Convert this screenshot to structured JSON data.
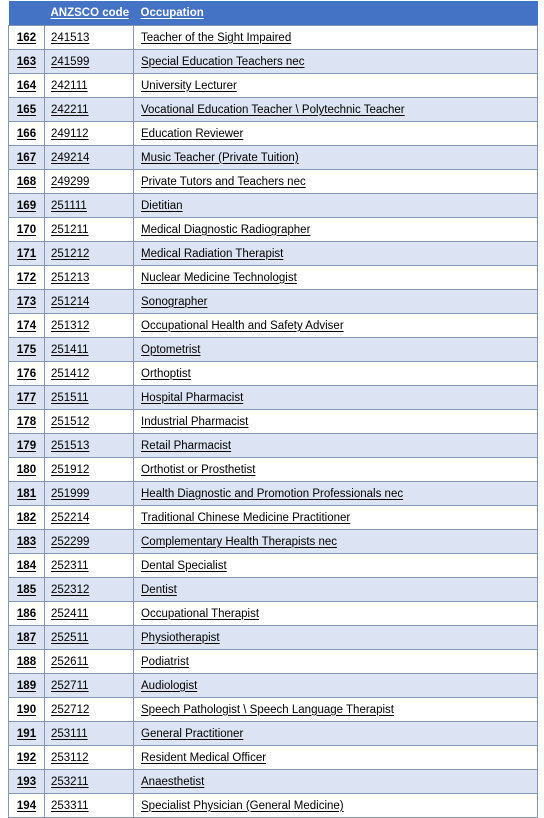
{
  "table": {
    "columns": [
      "",
      "ANZSCO code",
      "Occupation"
    ],
    "header": {
      "index_label": "",
      "code_label": "ANZSCO code",
      "occupation_label": "Occupation"
    },
    "rows": [
      {
        "index": "162",
        "code": "241513",
        "occupation": "Teacher of the Sight Impaired"
      },
      {
        "index": "163",
        "code": "241599",
        "occupation": "Special Education Teachers nec"
      },
      {
        "index": "164",
        "code": "242111",
        "occupation": "University Lecturer"
      },
      {
        "index": "165",
        "code": "242211",
        "occupation": "Vocational Education Teacher \\ Polytechnic Teacher"
      },
      {
        "index": "166",
        "code": "249112",
        "occupation": "Education Reviewer"
      },
      {
        "index": "167",
        "code": "249214",
        "occupation": "Music Teacher (Private Tuition)"
      },
      {
        "index": "168",
        "code": "249299",
        "occupation": "Private Tutors and Teachers nec"
      },
      {
        "index": "169",
        "code": "251111",
        "occupation": "Dietitian"
      },
      {
        "index": "170",
        "code": "251211",
        "occupation": "Medical Diagnostic Radiographer"
      },
      {
        "index": "171",
        "code": "251212",
        "occupation": "Medical Radiation Therapist"
      },
      {
        "index": "172",
        "code": "251213",
        "occupation": "Nuclear Medicine Technologist"
      },
      {
        "index": "173",
        "code": "251214",
        "occupation": "Sonographer"
      },
      {
        "index": "174",
        "code": "251312",
        "occupation": "Occupational Health and Safety Adviser"
      },
      {
        "index": "175",
        "code": "251411",
        "occupation": "Optometrist"
      },
      {
        "index": "176",
        "code": "251412",
        "occupation": "Orthoptist"
      },
      {
        "index": "177",
        "code": "251511",
        "occupation": "Hospital Pharmacist"
      },
      {
        "index": "178",
        "code": "251512",
        "occupation": "Industrial Pharmacist"
      },
      {
        "index": "179",
        "code": "251513",
        "occupation": "Retail Pharmacist"
      },
      {
        "index": "180",
        "code": "251912",
        "occupation": "Orthotist or Prosthetist"
      },
      {
        "index": "181",
        "code": "251999",
        "occupation": "Health Diagnostic and Promotion Professionals nec"
      },
      {
        "index": "182",
        "code": "252214",
        "occupation": "Traditional Chinese Medicine Practitioner"
      },
      {
        "index": "183",
        "code": "252299",
        "occupation": "Complementary Health Therapists nec"
      },
      {
        "index": "184",
        "code": "252311",
        "occupation": "Dental Specialist"
      },
      {
        "index": "185",
        "code": "252312",
        "occupation": "Dentist"
      },
      {
        "index": "186",
        "code": "252411",
        "occupation": "Occupational Therapist"
      },
      {
        "index": "187",
        "code": "252511",
        "occupation": "Physiotherapist"
      },
      {
        "index": "188",
        "code": "252611",
        "occupation": "Podiatrist"
      },
      {
        "index": "189",
        "code": "252711",
        "occupation": "Audiologist"
      },
      {
        "index": "190",
        "code": "252712",
        "occupation": "Speech Pathologist \\ Speech Language Therapist"
      },
      {
        "index": "191",
        "code": "253111",
        "occupation": "General Practitioner"
      },
      {
        "index": "192",
        "code": "253112",
        "occupation": "Resident Medical Officer"
      },
      {
        "index": "193",
        "code": "253211",
        "occupation": "Anaesthetist"
      },
      {
        "index": "194",
        "code": "253311",
        "occupation": "Specialist Physician (General Medicine)"
      }
    ]
  },
  "colors": {
    "header_background": "#4472C4",
    "header_text": "#FFFFFF",
    "row_alt_background": "#DCE3F2",
    "row_background": "#FFFFFF",
    "border": "#8496B0",
    "text": "#000000"
  }
}
